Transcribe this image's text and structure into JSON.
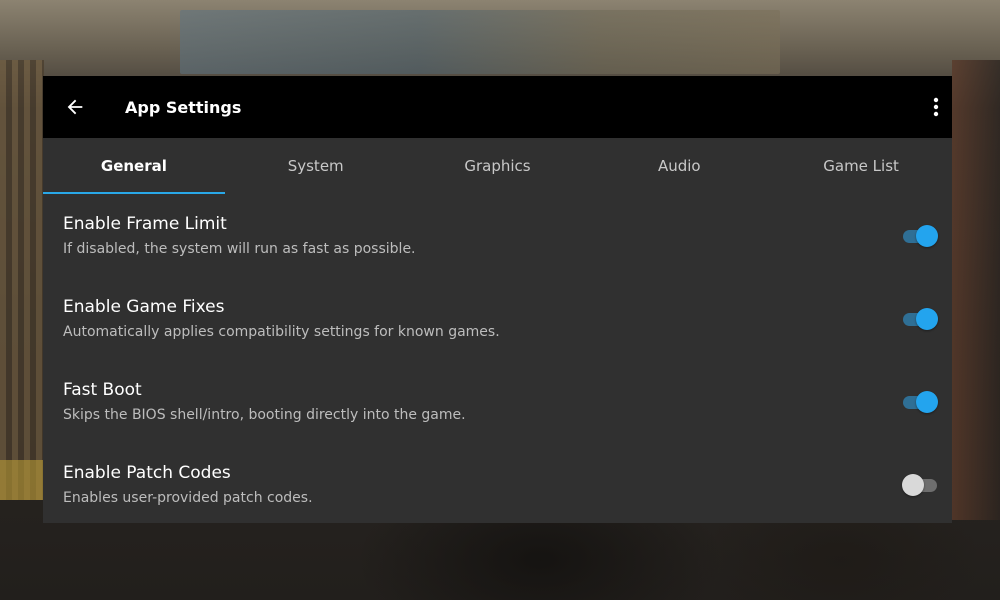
{
  "appbar": {
    "title": "App Settings",
    "back_icon": "arrow-left-icon",
    "menu_icon": "more-vert-icon"
  },
  "tabs": [
    {
      "label": "General",
      "active": true
    },
    {
      "label": "System",
      "active": false
    },
    {
      "label": "Graphics",
      "active": false
    },
    {
      "label": "Audio",
      "active": false
    },
    {
      "label": "Game List",
      "active": false
    }
  ],
  "settings": [
    {
      "title": "Enable Frame Limit",
      "description": "If disabled, the system will run as fast as possible.",
      "enabled": true
    },
    {
      "title": "Enable Game Fixes",
      "description": "Automatically applies compatibility settings for known games.",
      "enabled": true
    },
    {
      "title": "Fast Boot",
      "description": "Skips the BIOS shell/intro, booting directly into the game.",
      "enabled": true
    },
    {
      "title": "Enable Patch Codes",
      "description": "Enables user-provided patch codes.",
      "enabled": false
    }
  ],
  "colors": {
    "accent": "#29a8e8",
    "appbar_bg": "#000000",
    "panel_bg": "#303030",
    "switch_on_thumb": "#23a4ee",
    "switch_off_thumb": "#d9d9d9"
  }
}
